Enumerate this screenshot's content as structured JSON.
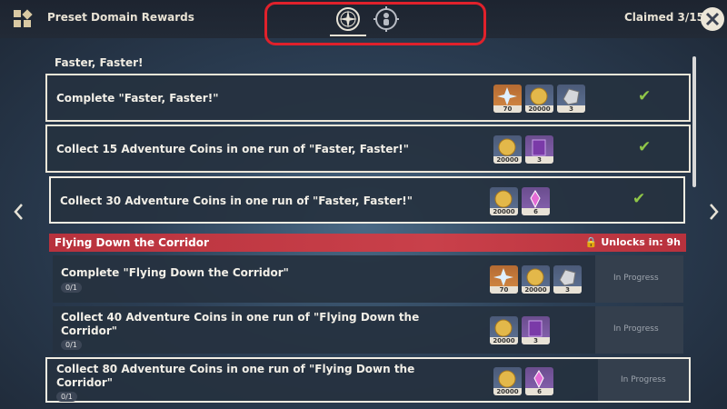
{
  "header": {
    "title": "Preset Domain Rewards",
    "claimed_label": "Claimed 3/15",
    "tabs": [
      {
        "icon": "compass-icon",
        "active": true
      },
      {
        "icon": "target-figure-icon",
        "active": false
      }
    ]
  },
  "sections": [
    {
      "title": "Faster, Faster!",
      "locked": false,
      "rows": [
        {
          "text_line1": "Complete \"Faster, Faster!\"",
          "rewards": [
            {
              "icon": "mora-exp-icon",
              "color": "orange",
              "qty": "70"
            },
            {
              "icon": "mora-icon",
              "color": "blue",
              "qty": "20000"
            },
            {
              "icon": "ore-icon",
              "color": "blue",
              "qty": "3"
            }
          ],
          "status": "claimed"
        },
        {
          "text_line1": "Collect 15 Adventure Coins in one run of \"Faster, Faster!\"",
          "rewards": [
            {
              "icon": "mora-icon",
              "color": "blue",
              "qty": "20000"
            },
            {
              "icon": "book-icon",
              "color": "purple",
              "qty": "3"
            }
          ],
          "status": "claimed"
        },
        {
          "text_line1": "Collect 30 Adventure Coins in one run of \"Faster, Faster!\"",
          "rewards": [
            {
              "icon": "mora-icon",
              "color": "blue",
              "qty": "20000"
            },
            {
              "icon": "crystal-icon",
              "color": "purple",
              "qty": "6"
            }
          ],
          "status": "claimed"
        }
      ]
    },
    {
      "title": "Flying Down the Corridor",
      "locked": true,
      "unlock_text": "Unlocks in: 9h",
      "rows": [
        {
          "text_line1": "Complete \"Flying Down the Corridor\"",
          "progress": "0/1",
          "status_text": "In Progress",
          "rewards": [
            {
              "icon": "mora-exp-icon",
              "color": "orange",
              "qty": "70"
            },
            {
              "icon": "mora-icon",
              "color": "blue",
              "qty": "20000"
            },
            {
              "icon": "ore-icon",
              "color": "blue",
              "qty": "3"
            }
          ]
        },
        {
          "text_line1": "Collect 40 Adventure Coins in one run of \"Flying Down the",
          "text_line2": "Corridor\"",
          "progress": "0/1",
          "status_text": "In Progress",
          "rewards": [
            {
              "icon": "mora-icon",
              "color": "blue",
              "qty": "20000"
            },
            {
              "icon": "book-icon",
              "color": "purple",
              "qty": "3"
            }
          ]
        },
        {
          "text_line1": "Collect 80 Adventure Coins in one run of \"Flying Down the",
          "text_line2": "Corridor\"",
          "progress": "0/1",
          "status_text": "In Progress",
          "rewards": [
            {
              "icon": "mora-icon",
              "color": "blue",
              "qty": "20000"
            },
            {
              "icon": "crystal-icon",
              "color": "purple",
              "qty": "6"
            }
          ]
        }
      ]
    }
  ],
  "colors": {
    "accent_red": "#e0212b",
    "check_green": "#8fc648",
    "locked_header": "#c9404a"
  }
}
